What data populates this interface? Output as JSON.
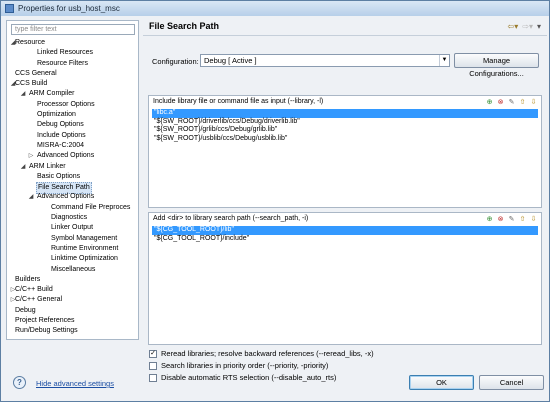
{
  "window": {
    "title": "Properties for usb_host_msc"
  },
  "filter": {
    "placeholder": "type filter text"
  },
  "tree": [
    {
      "label": "Resource",
      "level": 0,
      "arrow": "◢"
    },
    {
      "label": "Linked Resources",
      "level": 2,
      "arrow": ""
    },
    {
      "label": "Resource Filters",
      "level": 2,
      "arrow": ""
    },
    {
      "label": "CCS General",
      "level": 0,
      "arrow": ""
    },
    {
      "label": "CCS Build",
      "level": 0,
      "arrow": "◢"
    },
    {
      "label": "ARM Compiler",
      "level": 1,
      "arrow": "◢"
    },
    {
      "label": "Processor Options",
      "level": 2,
      "arrow": ""
    },
    {
      "label": "Optimization",
      "level": 2,
      "arrow": ""
    },
    {
      "label": "Debug Options",
      "level": 2,
      "arrow": ""
    },
    {
      "label": "Include Options",
      "level": 2,
      "arrow": ""
    },
    {
      "label": "MISRA-C:2004",
      "level": 2,
      "arrow": ""
    },
    {
      "label": "Advanced Options",
      "level": 2,
      "arrow": "▷"
    },
    {
      "label": "ARM Linker",
      "level": 1,
      "arrow": "◢"
    },
    {
      "label": "Basic Options",
      "level": 2,
      "arrow": ""
    },
    {
      "label": "File Search Path",
      "level": 2,
      "arrow": "",
      "selected": true
    },
    {
      "label": "Advanced Options",
      "level": 2,
      "arrow": "◢"
    },
    {
      "label": "Command File Preproces",
      "level": 3,
      "arrow": ""
    },
    {
      "label": "Diagnostics",
      "level": 3,
      "arrow": ""
    },
    {
      "label": "Linker Output",
      "level": 3,
      "arrow": ""
    },
    {
      "label": "Symbol Management",
      "level": 3,
      "arrow": ""
    },
    {
      "label": "Runtime Environment",
      "level": 3,
      "arrow": ""
    },
    {
      "label": "Linktime Optimization",
      "level": 3,
      "arrow": ""
    },
    {
      "label": "Miscellaneous",
      "level": 3,
      "arrow": ""
    },
    {
      "label": "Builders",
      "level": 0,
      "arrow": ""
    },
    {
      "label": "C/C++ Build",
      "level": 0,
      "arrow": "▷"
    },
    {
      "label": "C/C++ General",
      "level": 0,
      "arrow": "▷"
    },
    {
      "label": "Debug",
      "level": 0,
      "arrow": ""
    },
    {
      "label": "Project References",
      "level": 0,
      "arrow": ""
    },
    {
      "label": "Run/Debug Settings",
      "level": 0,
      "arrow": ""
    }
  ],
  "page": {
    "title": "File Search Path"
  },
  "configuration": {
    "label": "Configuration:",
    "value": "Debug  [ Active ]",
    "manage_label": "Manage Configurations..."
  },
  "libraries": {
    "title": "Include library file or command file as input (--library, -l)",
    "items": [
      "\"libc.a\"",
      "\"${SW_ROOT}/driverlib/ccs/Debug/driverlib.lib\"",
      "\"${SW_ROOT}/grlib/ccs/Debug/grlib.lib\"",
      "\"${SW_ROOT}/usblib/ccs/Debug/usblib.lib\""
    ],
    "selected_index": 0
  },
  "search_paths": {
    "title": "Add <dir> to library search path (--search_path, -i)",
    "items": [
      "\"${CG_TOOL_ROOT}/lib\"",
      "\"${CG_TOOL_ROOT}/include\""
    ],
    "selected_index": 0
  },
  "options": [
    {
      "label": "Reread libraries; resolve backward references (--reread_libs, -x)",
      "checked": true
    },
    {
      "label": "Search libraries in priority order (--priority, -priority)",
      "checked": false
    },
    {
      "label": "Disable automatic RTS selection (--disable_auto_rts)",
      "checked": false
    }
  ],
  "footer": {
    "hide_advanced": "Hide advanced settings",
    "ok_label": "OK",
    "cancel_label": "Cancel"
  },
  "icons": {
    "back": "back-arrow-icon",
    "forward": "forward-arrow-icon",
    "menu": "view-menu-icon",
    "add": "add-icon",
    "delete": "delete-icon",
    "edit": "edit-icon",
    "move_up": "move-up-icon",
    "move_down": "move-down-icon",
    "help": "help-icon"
  }
}
